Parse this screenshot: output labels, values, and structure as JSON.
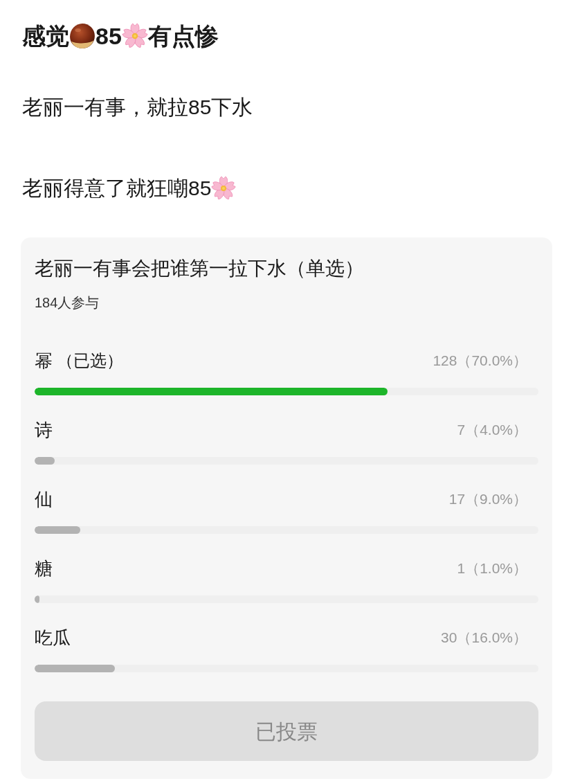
{
  "post": {
    "title": [
      {
        "kind": "text",
        "text": "感觉"
      },
      {
        "kind": "chestnut"
      },
      {
        "kind": "text",
        "text": "85"
      },
      {
        "kind": "blossom"
      },
      {
        "kind": "text",
        "text": "有点惨"
      }
    ],
    "paragraphs": [
      [
        {
          "kind": "text",
          "text": "老丽一有事，就拉85下水"
        }
      ],
      [
        {
          "kind": "text",
          "text": "老丽得意了就狂嘲85"
        },
        {
          "kind": "blossom"
        }
      ]
    ]
  },
  "poll": {
    "question": "老丽一有事会把谁第一拉下水（单选）",
    "participants": "184人参与",
    "options": [
      {
        "label": "幂",
        "note": "（已选）",
        "count": "128（70.0%）",
        "level": 0.7,
        "selected": true
      },
      {
        "label": "诗",
        "count": "7（4.0%）",
        "level": 0.04,
        "selected": false
      },
      {
        "label": "仙",
        "count": "17（9.0%）",
        "level": 0.09,
        "selected": false
      },
      {
        "label": "糖",
        "count": "1（1.0%）",
        "level": 0.01,
        "selected": false
      },
      {
        "label": "吃瓜",
        "count": "30（16.0%）",
        "level": 0.16,
        "selected": false
      }
    ],
    "button": {
      "label": "已投票",
      "disabled": true
    }
  }
}
